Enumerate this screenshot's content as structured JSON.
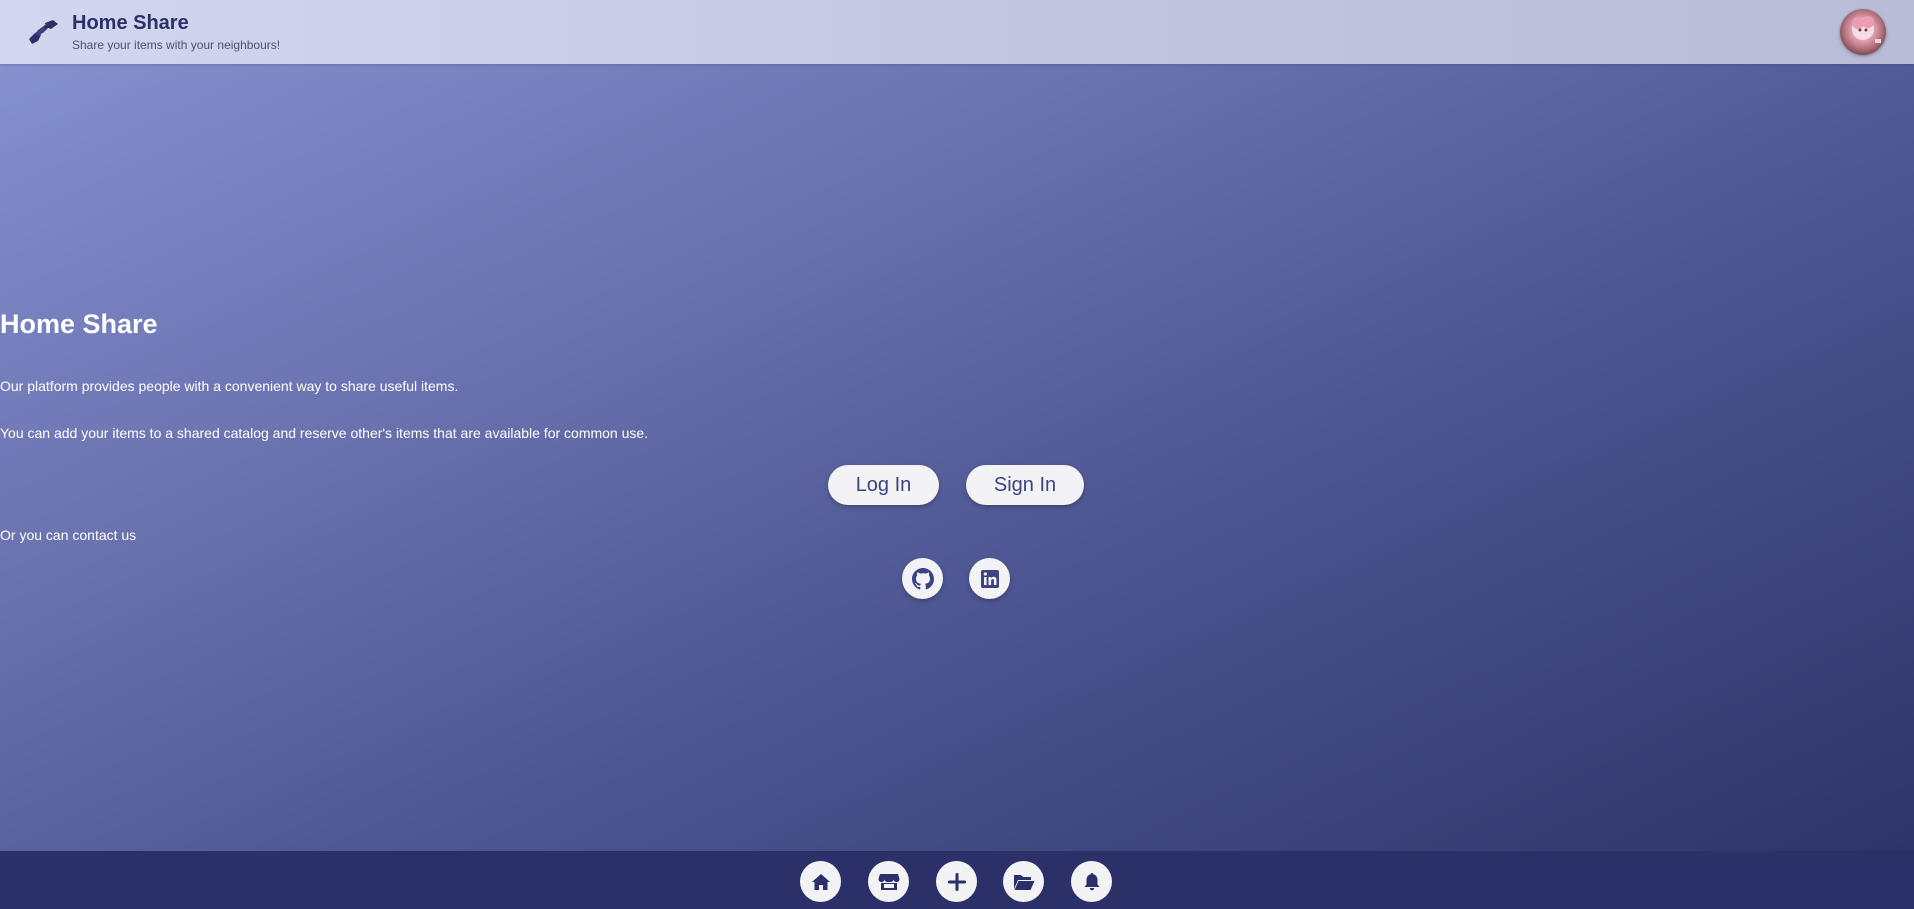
{
  "header": {
    "title": "Home Share",
    "subtitle": "Share your items with your neighbours!",
    "logo_icon": "handshake-icon",
    "avatar_icon": "user-avatar"
  },
  "hero": {
    "title": "Home Share",
    "description_1": "Our platform provides people with a convenient way to share useful items.",
    "description_2": "You can add your items to a shared catalog and reserve other's items that are available for common use.",
    "login_label": "Log In",
    "signin_label": "Sign In",
    "contact_text": "Or you can contact us",
    "social": [
      {
        "icon": "github-icon"
      },
      {
        "icon": "linkedin-icon"
      }
    ]
  },
  "footer_nav": [
    {
      "icon": "home-icon"
    },
    {
      "icon": "store-icon"
    },
    {
      "icon": "plus-icon"
    },
    {
      "icon": "folder-open-icon"
    },
    {
      "icon": "bell-icon"
    }
  ],
  "colors": {
    "header_bg": "#c7cae3",
    "brand_text": "#2b3167",
    "main_gradient_start": "#8590cf",
    "main_gradient_end": "#2e3468",
    "footer_bg": "#2b3168",
    "button_bg": "#f3f3f5",
    "button_text": "#3a4383"
  }
}
